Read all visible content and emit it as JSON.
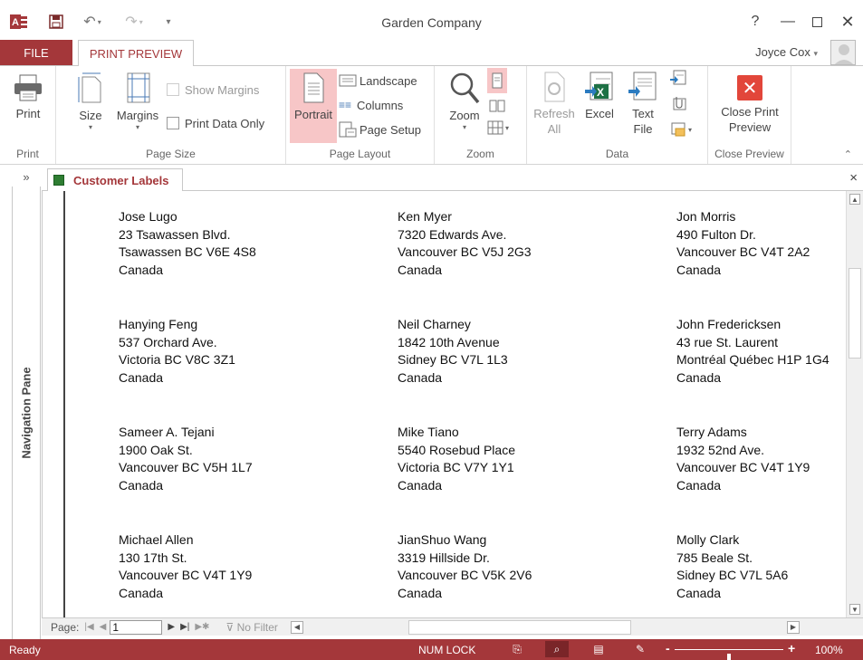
{
  "app": {
    "title": "Garden Company",
    "help": "?",
    "user_name": "Joyce Cox",
    "user_caret": "▾"
  },
  "tabs": {
    "file": "FILE",
    "print_preview": "PRINT PREVIEW"
  },
  "ribbon": {
    "print": {
      "button": "Print",
      "group": "Print"
    },
    "page_size": {
      "size": "Size",
      "margins": "Margins",
      "show_margins": "Show Margins",
      "print_data_only": "Print Data Only",
      "group": "Page Size"
    },
    "page_layout": {
      "portrait": "Portrait",
      "landscape": "Landscape",
      "columns": "Columns",
      "page_setup": "Page Setup",
      "group": "Page Layout"
    },
    "zoom": {
      "zoom": "Zoom",
      "group": "Zoom"
    },
    "data": {
      "refresh_line1": "Refresh",
      "refresh_line2": "All",
      "excel": "Excel",
      "text_line1": "Text",
      "text_line2": "File",
      "group": "Data"
    },
    "close_preview": {
      "line1": "Close Print",
      "line2": "Preview",
      "group": "Close Preview"
    }
  },
  "nav_pane": {
    "collapse": "»",
    "label": "Navigation Pane"
  },
  "document": {
    "tab_label": "Customer Labels",
    "close": "×",
    "labels": [
      [
        "Jose Lugo",
        "23 Tsawassen Blvd.",
        "Tsawassen BC  V6E 4S8",
        "Canada"
      ],
      [
        "Ken Myer",
        "7320 Edwards Ave.",
        "Vancouver BC  V5J 2G3",
        "Canada"
      ],
      [
        "Jon Morris",
        "490 Fulton Dr.",
        "Vancouver BC  V4T 2A2",
        "Canada"
      ],
      [
        "Hanying Feng",
        "537 Orchard Ave.",
        "Victoria BC  V8C 3Z1",
        "Canada"
      ],
      [
        "Neil Charney",
        "1842 10th Avenue",
        "Sidney BC  V7L 1L3",
        "Canada"
      ],
      [
        "John Fredericksen",
        "43 rue St. Laurent",
        "Montréal Québec  H1P 1G4",
        "Canada"
      ],
      [
        "Sameer A. Tejani",
        "1900 Oak St.",
        "Vancouver BC  V5H 1L7",
        "Canada"
      ],
      [
        "Mike Tiano",
        "5540 Rosebud Place",
        "Victoria BC  V7Y 1Y1",
        "Canada"
      ],
      [
        "Terry Adams",
        "1932 52nd Ave.",
        "Vancouver BC  V4T 1Y9",
        "Canada"
      ],
      [
        "Michael Allen",
        "130 17th St.",
        "Vancouver BC  V4T 1Y9",
        "Canada"
      ],
      [
        "JianShuo Wang",
        "3319 Hillside Dr.",
        "Vancouver BC  V5K 2V6",
        "Canada"
      ],
      [
        "Molly Clark",
        "785 Beale St.",
        "Sidney BC  V7L 5A6",
        "Canada"
      ]
    ]
  },
  "record_nav": {
    "page_label": "Page:",
    "page_value": "1",
    "no_filter": "No Filter"
  },
  "status": {
    "ready": "Ready",
    "num_lock": "NUM LOCK",
    "zoom_minus": "-",
    "zoom_plus": "+",
    "zoom_level": "100%",
    "zoom_fraction": 0.5
  },
  "colors": {
    "accent": "#a4373a",
    "selected_button": "#f7c6c7"
  }
}
